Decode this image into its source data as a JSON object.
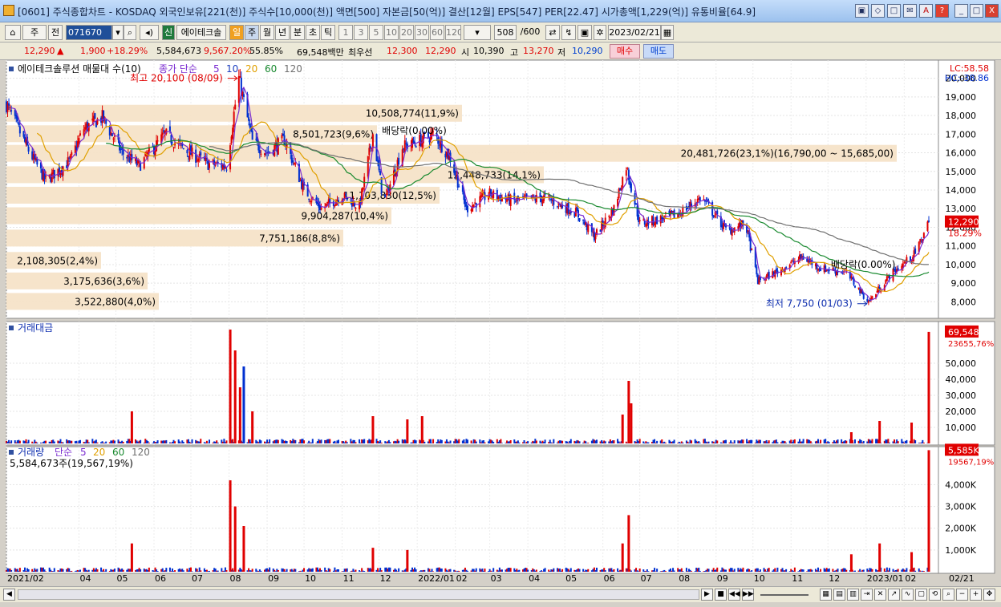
{
  "window": {
    "title": "[0601] 주식종합차트 - KOSDAQ 외국인보유[221(천)] 주식수[10,000(천)] 액면[500] 자본금[50(억)] 결산[12월] EPS[547] PER[22.47] 시가총액[1,229(억)] 유통비율[64.9]",
    "buttons": [
      "▣",
      "◇",
      "□",
      "✉",
      "A",
      "?",
      "_",
      "□",
      "X"
    ]
  },
  "toolbar": {
    "period_select": "주",
    "prev": "전",
    "code": "071670",
    "name_badge": "신",
    "stock_name": "에이테크솔",
    "interval_buttons": [
      "일",
      "주",
      "월",
      "년",
      "분",
      "초",
      "틱"
    ],
    "number_buttons": [
      "1",
      "3",
      "5",
      "10",
      "20",
      "30",
      "60",
      "120"
    ],
    "count": "508",
    "count_max": "/600",
    "date": "2023/02/21"
  },
  "pricebar": {
    "price": "12,290",
    "change": "1,900",
    "change_pct": "+18.29%",
    "volume": "5,584,673",
    "volume_pct": "9,567.20%",
    "ratio": "55.85%",
    "amount": "69,548백만",
    "best_label": "최우선",
    "ask": "12,300",
    "bid": "12,290",
    "open_label": "시",
    "open": "10,390",
    "high_label": "고",
    "high": "13,270",
    "low_label": "저",
    "low": "10,290",
    "buy": "매수",
    "sell": "매도"
  },
  "colors": {
    "up": "#e00000",
    "down": "#0030d0",
    "ma5": "#7a2ad0",
    "ma10": "#1e40c0",
    "ma20": "#e0a000",
    "ma60": "#1a8a30",
    "ma120": "#707070",
    "profile": "#f5e3c8"
  },
  "chart_data": {
    "type": "candlestick",
    "price_panel": {
      "legend_title": "에이테크솔루션 매물대 수(10)",
      "legend_ma_label": "종가 단순",
      "legend_ma_periods": [
        "5",
        "10",
        "20",
        "60",
        "120"
      ],
      "lc_label": "LC:58.58",
      "hc_label": "HC:-38.86",
      "y_ticks": [
        8000,
        9000,
        10000,
        11000,
        12000,
        13000,
        14000,
        15000,
        16000,
        17000,
        18000,
        19000,
        20000
      ],
      "ylim": [
        7200,
        20800
      ],
      "last_price": "12,290",
      "last_pct": "18.29%",
      "high_note": "최고 20,100 (08/09)",
      "low_note": "최저 7,750 (01/03)",
      "dividend_notes": [
        {
          "label": "배당락(0.00%)",
          "date": "2021-12-27"
        },
        {
          "label": "배당락(0.00%)",
          "date": "2022-12-27"
        }
      ],
      "volume_profile": [
        {
          "label": "3,522,880(4,0%)",
          "price": 8000
        },
        {
          "label": "3,175,636(3,6%)",
          "price": 9100
        },
        {
          "label": "2,108,305(2,4%)",
          "price": 10200
        },
        {
          "label": "7,751,186(8,8%)",
          "price": 11400
        },
        {
          "label": "9,904,287(10,4%)",
          "price": 12600
        },
        {
          "label": "11,103,830(12,5%)",
          "price": 13700
        },
        {
          "label": "12,448,733(14,1%)",
          "price": 14800
        },
        {
          "label": "20,481,726(23,1%)(16,790,00 ~ 15,685,00)",
          "price": 15950
        },
        {
          "label": "8,501,723(9,6%)",
          "price": 17000
        },
        {
          "label": "10,508,774(11,9%)",
          "price": 18100
        }
      ],
      "price_path": [
        [
          "2021-02-01",
          18600
        ],
        [
          "2021-02-20",
          16000
        ],
        [
          "2021-03-05",
          14500
        ],
        [
          "2021-03-25",
          15600
        ],
        [
          "2021-04-05",
          17300
        ],
        [
          "2021-04-20",
          17900
        ],
        [
          "2021-05-06",
          16000
        ],
        [
          "2021-05-20",
          15300
        ],
        [
          "2021-06-10",
          17000
        ],
        [
          "2021-06-25",
          16200
        ],
        [
          "2021-07-15",
          15400
        ],
        [
          "2021-07-30",
          15300
        ],
        [
          "2021-08-09",
          20000
        ],
        [
          "2021-08-20",
          16600
        ],
        [
          "2021-09-01",
          16000
        ],
        [
          "2021-09-15",
          16700
        ],
        [
          "2021-10-01",
          14000
        ],
        [
          "2021-10-15",
          13000
        ],
        [
          "2021-11-01",
          13700
        ],
        [
          "2021-11-15",
          13100
        ],
        [
          "2021-11-26",
          17000
        ],
        [
          "2021-12-05",
          13300
        ],
        [
          "2021-12-20",
          16300
        ],
        [
          "2022-01-05",
          16700
        ],
        [
          "2022-01-15",
          17000
        ],
        [
          "2022-01-28",
          15700
        ],
        [
          "2022-02-10",
          13000
        ],
        [
          "2022-03-01",
          13800
        ],
        [
          "2022-03-20",
          13400
        ],
        [
          "2022-04-15",
          13600
        ],
        [
          "2022-05-10",
          12800
        ],
        [
          "2022-05-25",
          11500
        ],
        [
          "2022-06-10",
          13000
        ],
        [
          "2022-06-20",
          15300
        ],
        [
          "2022-07-01",
          12200
        ],
        [
          "2022-07-15",
          12400
        ],
        [
          "2022-08-01",
          12700
        ],
        [
          "2022-08-20",
          13600
        ],
        [
          "2022-09-10",
          11800
        ],
        [
          "2022-09-25",
          12200
        ],
        [
          "2022-10-05",
          9100
        ],
        [
          "2022-10-20",
          9600
        ],
        [
          "2022-11-10",
          10400
        ],
        [
          "2022-11-25",
          9800
        ],
        [
          "2022-12-15",
          9600
        ],
        [
          "2023-01-03",
          8000
        ],
        [
          "2023-01-20",
          9400
        ],
        [
          "2023-02-10",
          10600
        ],
        [
          "2023-02-21",
          12290
        ]
      ]
    },
    "amount_panel": {
      "title": "거래대금",
      "y_ticks": [
        10000,
        20000,
        30000,
        40000,
        50000
      ],
      "ylim": [
        0,
        74000
      ],
      "last_label": "69,548",
      "last_pct_label": "23655,76%",
      "spikes": [
        [
          "2021-05-14",
          20000
        ],
        [
          "2021-08-02",
          71000
        ],
        [
          "2021-08-06",
          58000
        ],
        [
          "2021-08-10",
          35000
        ],
        [
          "2021-08-13",
          48000
        ],
        [
          "2021-08-20",
          20000
        ],
        [
          "2021-11-26",
          17000
        ],
        [
          "2021-12-24",
          15000
        ],
        [
          "2022-01-05",
          17000
        ],
        [
          "2022-06-17",
          18000
        ],
        [
          "2022-06-22",
          39000
        ],
        [
          "2022-06-24",
          25000
        ],
        [
          "2022-12-20",
          7000
        ],
        [
          "2023-01-12",
          14000
        ],
        [
          "2023-02-07",
          13000
        ],
        [
          "2023-02-21",
          69548
        ]
      ]
    },
    "volume_panel": {
      "title": "거래량",
      "legend_ma_label": "단순",
      "legend_ma_periods": [
        "5",
        "20",
        "60",
        "120"
      ],
      "summary": "5,584,673주(19,567,19%)",
      "y_ticks": [
        1000,
        2000,
        3000,
        4000
      ],
      "y_tick_labels": [
        "1,000K",
        "2,000K",
        "3,000K",
        "4,000K"
      ],
      "ylim": [
        0,
        5600
      ],
      "last_label": "5,585K",
      "last_pct_label": "19567,19%",
      "spikes": [
        [
          "2021-05-14",
          1300
        ],
        [
          "2021-08-02",
          4200
        ],
        [
          "2021-08-06",
          3000
        ],
        [
          "2021-08-13",
          2100
        ],
        [
          "2021-11-26",
          1100
        ],
        [
          "2021-12-24",
          1000
        ],
        [
          "2022-06-17",
          1300
        ],
        [
          "2022-06-22",
          2600
        ],
        [
          "2022-12-20",
          800
        ],
        [
          "2023-01-12",
          1300
        ],
        [
          "2023-02-07",
          900
        ],
        [
          "2023-02-21",
          5585
        ]
      ]
    },
    "x_ticks": [
      {
        "label": "2021/02",
        "date": "2021-02-01"
      },
      {
        "label": "04",
        "date": "2021-04-01"
      },
      {
        "label": "05",
        "date": "2021-05-01"
      },
      {
        "label": "06",
        "date": "2021-06-01"
      },
      {
        "label": "07",
        "date": "2021-07-01"
      },
      {
        "label": "08",
        "date": "2021-08-01"
      },
      {
        "label": "09",
        "date": "2021-09-01"
      },
      {
        "label": "10",
        "date": "2021-10-01"
      },
      {
        "label": "11",
        "date": "2021-11-01"
      },
      {
        "label": "12",
        "date": "2021-12-01"
      },
      {
        "label": "2022/01",
        "date": "2022-01-01"
      },
      {
        "label": "02",
        "date": "2022-02-01"
      },
      {
        "label": "03",
        "date": "2022-03-01"
      },
      {
        "label": "04",
        "date": "2022-04-01"
      },
      {
        "label": "05",
        "date": "2022-05-01"
      },
      {
        "label": "06",
        "date": "2022-06-01"
      },
      {
        "label": "07",
        "date": "2022-07-01"
      },
      {
        "label": "08",
        "date": "2022-08-01"
      },
      {
        "label": "09",
        "date": "2022-09-01"
      },
      {
        "label": "10",
        "date": "2022-10-01"
      },
      {
        "label": "11",
        "date": "2022-11-01"
      },
      {
        "label": "12",
        "date": "2022-12-01"
      },
      {
        "label": "2023/01",
        "date": "2023-01-01"
      },
      {
        "label": "02",
        "date": "2023-02-01"
      }
    ],
    "x_axis_end_label": "02/21",
    "xlim": [
      "2021-02-01",
      "2023-02-21"
    ]
  }
}
